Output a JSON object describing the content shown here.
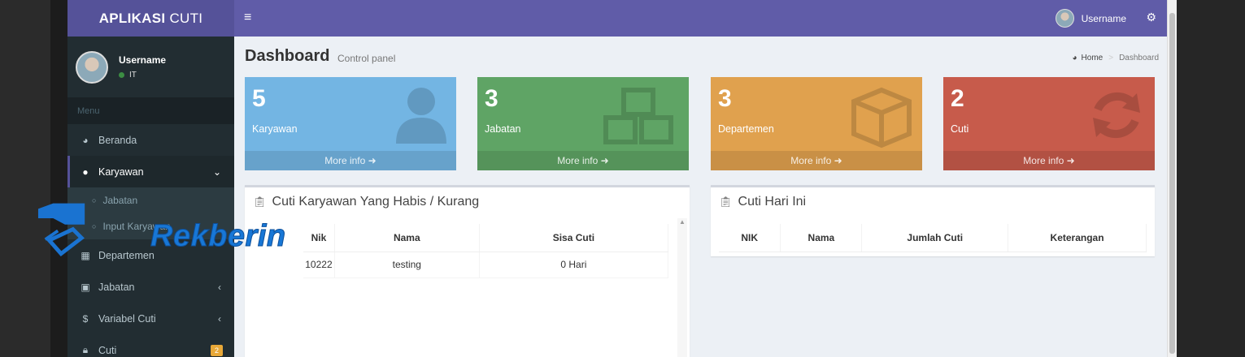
{
  "app": {
    "title_bold": "APLIKASI",
    "title_rest": "CUTI"
  },
  "sidebar": {
    "user_name": "Username",
    "user_status": "IT",
    "menu_header": "Menu",
    "items": [
      {
        "label": "Beranda",
        "icon": "dashboard-icon"
      },
      {
        "label": "Karyawan",
        "icon": "user-icon"
      },
      {
        "label": "Jabatan",
        "icon": "circle-icon",
        "sub": true
      },
      {
        "label": "Input Karyawan",
        "icon": "circle-icon",
        "sub": true
      },
      {
        "label": "Departemen",
        "icon": "building-icon"
      },
      {
        "label": "Jabatan",
        "icon": "briefcase-icon"
      },
      {
        "label": "Variabel Cuti",
        "icon": "dollar-icon"
      },
      {
        "label": "Cuti",
        "icon": "lock-icon",
        "badge": "2"
      }
    ]
  },
  "topnav": {
    "user_name": "Username"
  },
  "header": {
    "title": "Dashboard",
    "subtitle": "Control panel"
  },
  "breadcrumb": {
    "home": "Home",
    "current": "Dashboard"
  },
  "stat_boxes": [
    {
      "value": "5",
      "label": "Karyawan",
      "footer": "More info",
      "color": "#73b5e3",
      "icon": "user-icon"
    },
    {
      "value": "3",
      "label": "Jabatan",
      "footer": "More info",
      "color": "#5fa465",
      "icon": "cubes-icon"
    },
    {
      "value": "3",
      "label": "Departemen",
      "footer": "More info",
      "color": "#e0a14e",
      "icon": "cube-icon"
    },
    {
      "value": "2",
      "label": "Cuti",
      "footer": "More info",
      "color": "#c75b4b",
      "icon": "refresh-icon"
    }
  ],
  "panel_low": {
    "title": "Cuti Karyawan Yang Habis / Kurang",
    "columns": [
      "Nik",
      "Nama",
      "Sisa Cuti"
    ],
    "rows": [
      [
        "10222",
        "testing",
        "0 Hari"
      ]
    ]
  },
  "panel_today": {
    "title": "Cuti Hari Ini",
    "columns": [
      "NIK",
      "Nama",
      "Jumlah Cuti",
      "Keterangan"
    ]
  },
  "watermark": {
    "text": "Rekberin"
  }
}
